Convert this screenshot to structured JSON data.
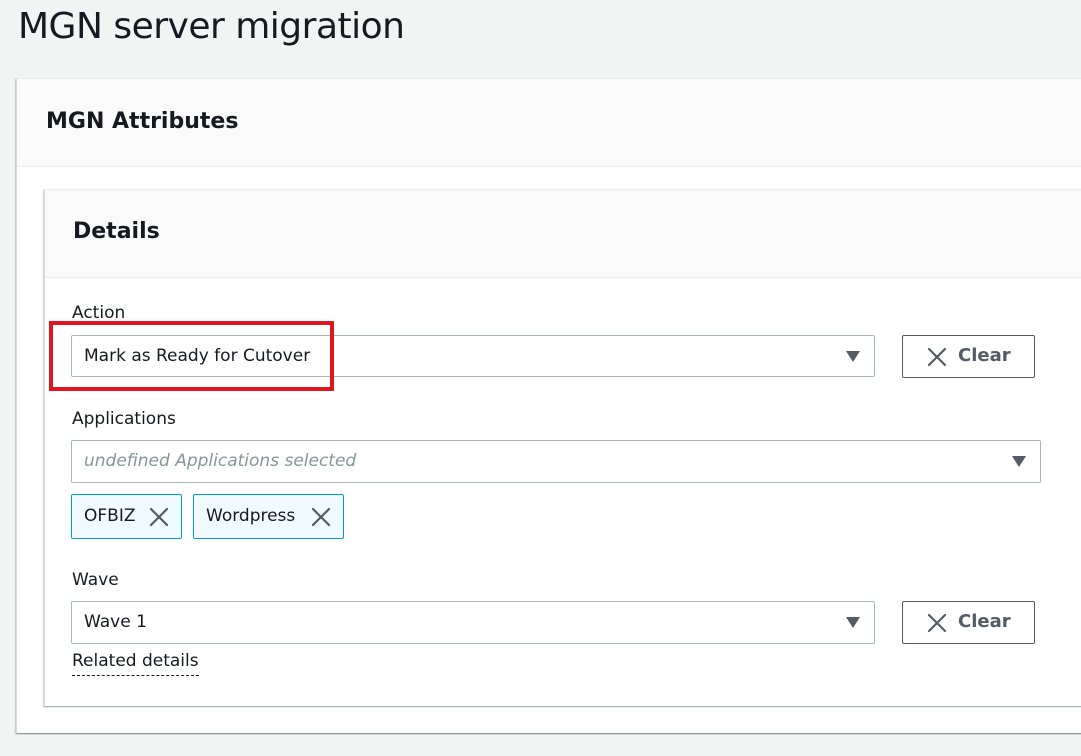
{
  "page": {
    "title": "MGN server migration"
  },
  "outer_container": {
    "header": "MGN Attributes"
  },
  "details_container": {
    "header": "Details"
  },
  "action_field": {
    "label": "Action",
    "selected_value": "Mark as Ready for Cutover",
    "clear_label": "Clear"
  },
  "applications_field": {
    "label": "Applications",
    "placeholder": "undefined Applications selected",
    "tokens": [
      "OFBIZ",
      "Wordpress"
    ]
  },
  "wave_field": {
    "label": "Wave",
    "selected_value": "Wave 1",
    "clear_label": "Clear"
  },
  "related_details": {
    "label": "Related details"
  },
  "icons": {
    "caret": "caret-down-icon",
    "close": "close-icon"
  },
  "colors": {
    "highlight": "#e0161d",
    "token_border": "#00a1c9",
    "token_bg": "#f1faff",
    "text": "#16191f",
    "button_text": "#545b64"
  }
}
